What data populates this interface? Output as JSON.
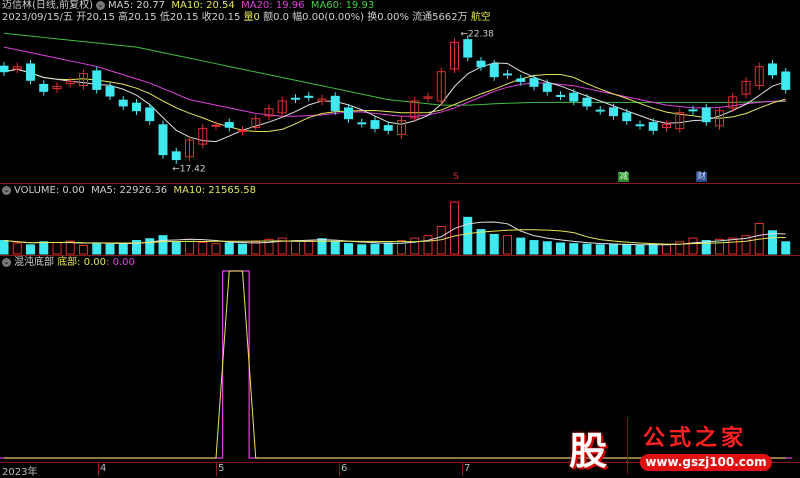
{
  "header": {
    "stock_name": "迈信林(日线,前复权)",
    "ma5": "MA5: 20.77",
    "ma10": "MA10: 20.54",
    "ma20": "MA20: 19.96",
    "ma60": "MA60: 19.93",
    "date": "2023/09/15/五",
    "open": "开20.15",
    "high": "高20.15",
    "low": "低20.15",
    "close": "收20.15",
    "vol_label": "量",
    "vol_value": "0",
    "amount": "额0.0",
    "change": "幅0.00(0.00%)",
    "turnover": "换0.00%",
    "float": "流通5662万",
    "sector": "航空"
  },
  "main": {
    "max_label": "22.38",
    "min_label": "17.42",
    "markers": {
      "s": "S",
      "reduce": "减",
      "finance": "财"
    }
  },
  "volume": {
    "title": "VOLUME: 0.00",
    "ma5": "MA5: 22926.36",
    "ma10": "MA10: 21565.58"
  },
  "indicator": {
    "title": "混沌底部",
    "label": "底部: 0.00",
    "value2": ": 0.00"
  },
  "axis": {
    "labels": [
      "2023年",
      "4",
      "5",
      "6",
      "7"
    ]
  },
  "watermark": {
    "char": "股",
    "name": "公式之家",
    "url": "www.gszj100.com"
  },
  "colors": {
    "up": "#e03030",
    "down": "#40e8f0",
    "ma5": "#e0e0e0",
    "ma10": "#e6e65a",
    "ma20": "#e040e0",
    "ma60": "#40c040"
  },
  "chart_data": {
    "type": "candlestick",
    "price_range": [
      17.2,
      22.7
    ],
    "close": [
      21.01,
      21.19,
      20.7,
      20.3,
      20.48,
      20.66,
      20.94,
      20.37,
      20.13,
      19.77,
      19.6,
      19.24,
      18.01,
      17.83,
      18.54,
      18.96,
      19.07,
      19.0,
      18.89,
      19.31,
      19.67,
      19.95,
      20.02,
      20.1,
      20.02,
      19.6,
      19.31,
      19.14,
      18.96,
      18.89,
      19.24,
      19.95,
      20.1,
      21.01,
      22.07,
      21.54,
      21.19,
      20.83,
      20.9,
      20.66,
      20.48,
      20.3,
      20.13,
      19.95,
      19.77,
      19.6,
      19.42,
      19.24,
      19.07,
      18.89,
      19.1,
      19.53,
      19.6,
      19.2,
      19.6,
      20.1,
      20.66,
      21.19,
      20.9,
      20.37
    ],
    "ma20": [
      21.9,
      21.8,
      21.7,
      21.6,
      21.5,
      21.4,
      21.3,
      21.2,
      21.05,
      20.9,
      20.75,
      20.6,
      20.4,
      20.2,
      20.0,
      19.9,
      19.8,
      19.7,
      19.6,
      19.5,
      19.45,
      19.4,
      19.4,
      19.42,
      19.45,
      19.5,
      19.55,
      19.55,
      19.5,
      19.45,
      19.4,
      19.4,
      19.45,
      19.55,
      19.7,
      19.9,
      20.1,
      20.3,
      20.45,
      20.55,
      20.6,
      20.6,
      20.55,
      20.5,
      20.4,
      20.3,
      20.2,
      20.1,
      20.0,
      19.9,
      19.8,
      19.75,
      19.7,
      19.7,
      19.72,
      19.78,
      19.85,
      19.9,
      19.94,
      19.96
    ],
    "ma60": [
      22.4,
      22.35,
      22.3,
      22.25,
      22.2,
      22.15,
      22.1,
      22.05,
      22.0,
      21.95,
      21.9,
      21.8,
      21.7,
      21.6,
      21.5,
      21.4,
      21.3,
      21.2,
      21.1,
      21.0,
      20.9,
      20.8,
      20.7,
      20.6,
      20.5,
      20.4,
      20.3,
      20.2,
      20.1,
      20.0,
      19.95,
      19.9,
      19.85,
      19.8,
      19.8,
      19.8,
      19.82,
      19.85,
      19.87,
      19.88,
      19.9,
      19.9,
      19.9,
      19.9,
      19.9,
      19.9,
      19.9,
      19.9,
      19.9,
      19.9,
      19.9,
      19.9,
      19.9,
      19.9,
      19.9,
      19.9,
      19.91,
      19.92,
      19.93,
      19.93
    ],
    "volume": [
      22000,
      18000,
      15000,
      20000,
      19000,
      21000,
      14000,
      17000,
      16000,
      18000,
      22000,
      25000,
      30000,
      20000,
      24000,
      19000,
      17000,
      18000,
      16000,
      20000,
      24000,
      26000,
      22000,
      21000,
      25000,
      20000,
      17000,
      15000,
      16000,
      18000,
      22000,
      26000,
      30000,
      45000,
      85000,
      60000,
      40000,
      32000,
      30000,
      26000,
      22000,
      20000,
      18000,
      17000,
      16000,
      15000,
      16000,
      15000,
      14000,
      16000,
      15000,
      20000,
      26000,
      22000,
      24000,
      26000,
      30000,
      50000,
      38000,
      20000
    ],
    "bottom_signal": [
      0,
      0,
      0,
      0,
      0,
      0,
      0,
      0,
      0,
      0,
      0,
      0,
      0,
      0,
      0,
      0,
      0,
      1,
      1,
      0,
      0,
      0,
      0,
      0,
      0,
      0,
      0,
      0,
      0,
      0,
      0,
      0,
      0,
      0,
      0,
      0,
      0,
      0,
      0,
      0,
      0,
      0,
      0,
      0,
      0,
      0,
      0,
      0,
      0,
      0,
      0,
      0,
      0,
      0,
      0,
      0,
      0,
      0,
      0,
      0
    ]
  }
}
